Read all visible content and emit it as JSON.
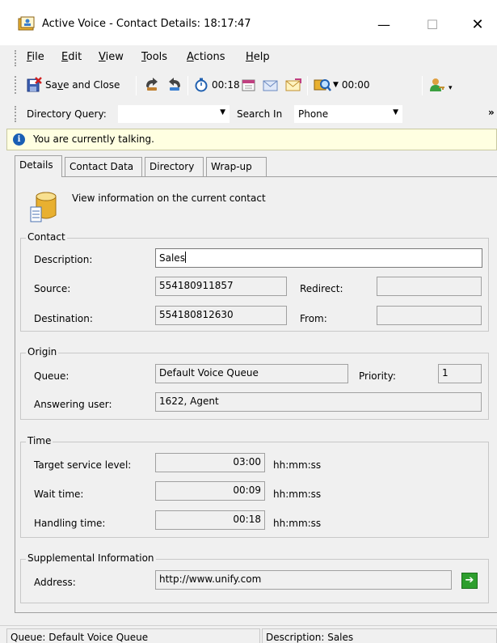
{
  "window": {
    "title": "Active Voice - Contact Details: 18:17:47",
    "minimize_glyph": "—",
    "maximize_glyph": "☐",
    "close_glyph": "✕",
    "icons": {
      "app": "address-book-icon"
    }
  },
  "menu": [
    {
      "label": "File",
      "hotkey": "F"
    },
    {
      "label": "Edit",
      "hotkey": "E"
    },
    {
      "label": "View",
      "hotkey": "V"
    },
    {
      "label": "Tools",
      "hotkey": "T"
    },
    {
      "label": "Actions",
      "hotkey": "A"
    },
    {
      "label": "Help",
      "hotkey": "H"
    }
  ],
  "toolbar": {
    "save_close_prefix": "Sa",
    "save_close_hotkey": "v",
    "save_close_suffix": "e and Close",
    "call_timer": "00:18",
    "wrap_timer": "00:00",
    "icons": [
      "save-close-icon",
      "transfer-icon",
      "consult-icon",
      "stopwatch-icon",
      "calendar-icon",
      "email-icon",
      "email-forward-icon",
      "find-contact-icon",
      "user-key-icon"
    ]
  },
  "query": {
    "directory_label": "Directory Query:",
    "directory_value": "",
    "search_in_label": "Search In",
    "search_in_value": "Phone",
    "more_glyph": "»"
  },
  "info": {
    "icon_glyph": "i",
    "message": "You are currently talking."
  },
  "tabs": [
    "Details",
    "Contact Data",
    "Directory",
    "Wrap-up"
  ],
  "details": {
    "heading": "View information on the current contact",
    "contact": {
      "legend": "Contact",
      "description_label": "Description:",
      "description_value": "Sales",
      "source_label": "Source:",
      "source_value": "554180911857",
      "redirect_label": "Redirect:",
      "redirect_value": "",
      "destination_label": "Destination:",
      "destination_value": "554180812630",
      "from_label": "From:",
      "from_value": ""
    },
    "origin": {
      "legend": "Origin",
      "queue_label": "Queue:",
      "queue_value": "Default Voice Queue",
      "priority_label": "Priority:",
      "priority_value": "1",
      "answering_label": "Answering user:",
      "answering_value": "1622, Agent"
    },
    "time": {
      "legend": "Time",
      "target_label": "Target service level:",
      "target_value": "03:00",
      "wait_label": "Wait time:",
      "wait_value": "00:09",
      "handling_label": "Handling time:",
      "handling_value": "00:18",
      "unit": "hh:mm:ss"
    },
    "supplemental": {
      "legend": "Supplemental Information",
      "address_label": "Address:",
      "address_value": "http://www.unify.com",
      "go_glyph": "➔"
    }
  },
  "status": {
    "queue": "Queue: Default Voice Queue",
    "description": "Description: Sales"
  }
}
